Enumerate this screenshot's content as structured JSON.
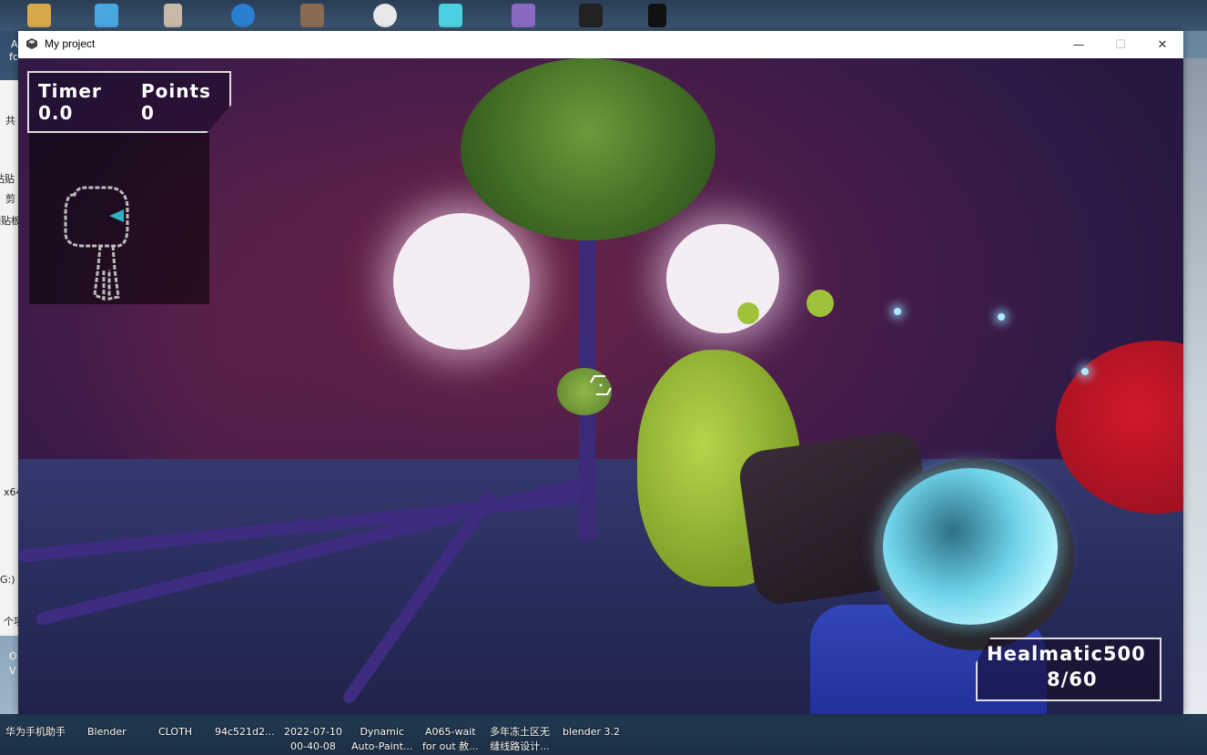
{
  "window": {
    "title": "My project",
    "minimize_glyph": "—",
    "maximize_glyph": "☐",
    "close_glyph": "✕"
  },
  "hud": {
    "timer_label": "Timer",
    "timer_value": "0.0",
    "points_label": "Points",
    "points_value": "0",
    "weapon_name": "Healmatic500",
    "ammo": "8/60"
  },
  "desktop": {
    "left_fragments": [
      "A",
      "fc",
      "共",
      "粘贴",
      "剪",
      "制贴板",
      "x64",
      "G:)",
      "个项",
      "O",
      "V"
    ],
    "taskbar_items": [
      {
        "label": "华为手机助手"
      },
      {
        "label": "Blender"
      },
      {
        "label": "CLOTH"
      },
      {
        "label": "94c521d2..."
      },
      {
        "label": "2022-07-10\n00-40-08"
      },
      {
        "label": "Dynamic\nAuto-Paint..."
      },
      {
        "label": "A065-wait\nfor out 赦..."
      },
      {
        "label": "多年冻土区无\n缝线路设计..."
      },
      {
        "label": "blender 3.2"
      }
    ]
  },
  "colors": {
    "hud_border": "#ffffff",
    "minimap_marker": "#2bb3c0",
    "gun_glow": "#6fd3e8"
  }
}
